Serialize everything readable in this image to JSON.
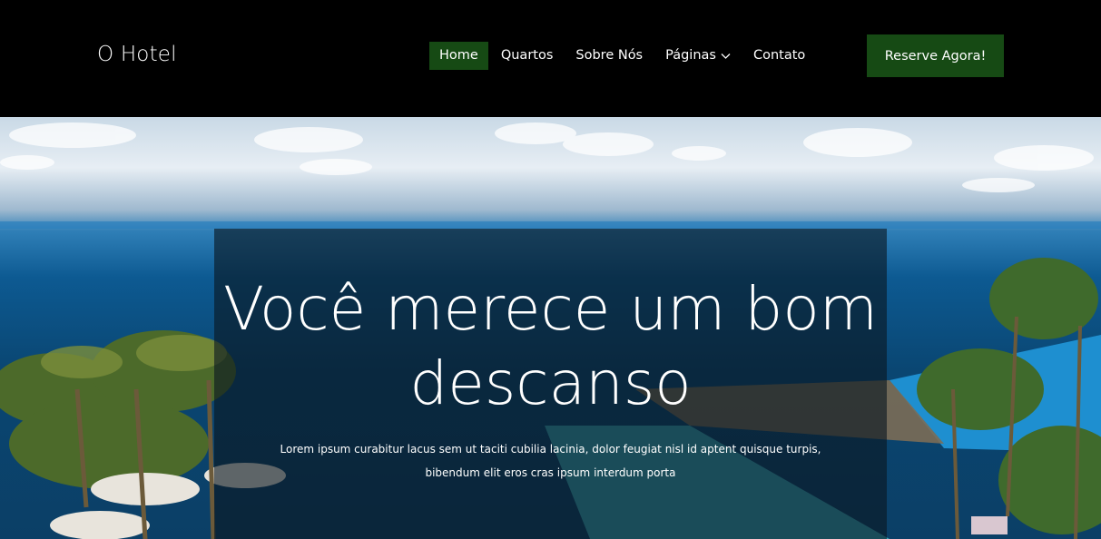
{
  "header": {
    "logo": "O Hotel",
    "nav": [
      {
        "label": "Home",
        "active": true
      },
      {
        "label": "Quartos",
        "active": false
      },
      {
        "label": "Sobre Nós",
        "active": false
      },
      {
        "label": "Páginas",
        "active": false,
        "dropdown": true
      },
      {
        "label": "Contato",
        "active": false
      }
    ],
    "cta_label": "Reserve Agora!"
  },
  "hero": {
    "headline_line1": "Você merece um bom",
    "headline_line2": "descanso",
    "subtext": "Lorem ipsum curabitur lacus sem ut taciti cubilia lacinia, dolor feugiat nisl id aptent quisque turpis, bibendum elit eros cras ipsum interdum porta"
  },
  "colors": {
    "header_bg": "#000000",
    "accent": "#164a14",
    "text": "#ffffff"
  },
  "icons": {
    "dropdown": "chevron-down-icon"
  }
}
